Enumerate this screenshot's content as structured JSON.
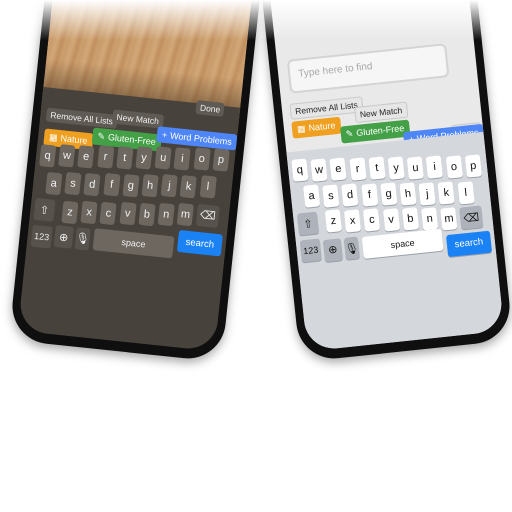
{
  "keyboard": {
    "row1": [
      "q",
      "w",
      "e",
      "r",
      "t",
      "y",
      "u",
      "i",
      "o",
      "p"
    ],
    "row2": [
      "a",
      "s",
      "d",
      "f",
      "g",
      "h",
      "j",
      "k",
      "l"
    ],
    "row3": [
      "z",
      "x",
      "c",
      "v",
      "b",
      "n",
      "m"
    ],
    "numbers_label": "123",
    "space_label": "space",
    "search_label": "search",
    "globe_icon": "globe-icon",
    "mic_icon": "microphone-icon",
    "shift_icon": "shift-icon",
    "delete_icon": "delete-icon"
  },
  "toolbar": {
    "done_label": "Done",
    "remove_all_label": "Remove All Lists",
    "new_match_label": "New Match"
  },
  "tags": [
    {
      "label": "Nature",
      "color": "#f0a020",
      "icon": "grid-icon"
    },
    {
      "label": "Gluten-Free",
      "color": "#43a047",
      "icon": "edit-icon"
    },
    {
      "label": "Word Problems",
      "color": "#4f86f7",
      "icon": "plus-icon"
    }
  ],
  "search": {
    "placeholder": "Type here to find"
  },
  "colors": {
    "accent": "#1b82f5"
  }
}
